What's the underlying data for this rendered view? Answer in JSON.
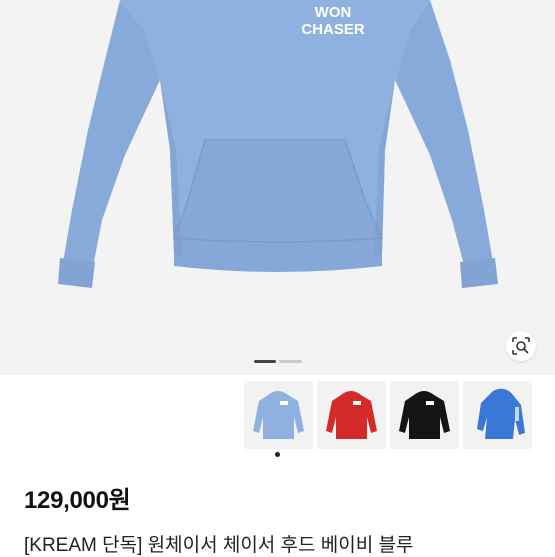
{
  "product": {
    "price": "129,000원",
    "title": "[KREAM 단독] 원체이서 체이서 후드 베이비 블루"
  },
  "hero": {
    "print_line1": "WON",
    "print_line2": "CHASER",
    "body_color": "#8fb1df",
    "shadow_color": "#7a9ccb"
  },
  "carousel": {
    "current_page": 1,
    "total_pages": 2
  },
  "thumbnails": [
    {
      "name": "baby-blue",
      "color": "#8fb1df"
    },
    {
      "name": "red",
      "color": "#d42a2a"
    },
    {
      "name": "black",
      "color": "#141414"
    },
    {
      "name": "blue",
      "color": "#3a78d8"
    }
  ],
  "selected_thumbnail": 0,
  "icons": {
    "lens": "image-search-icon"
  }
}
